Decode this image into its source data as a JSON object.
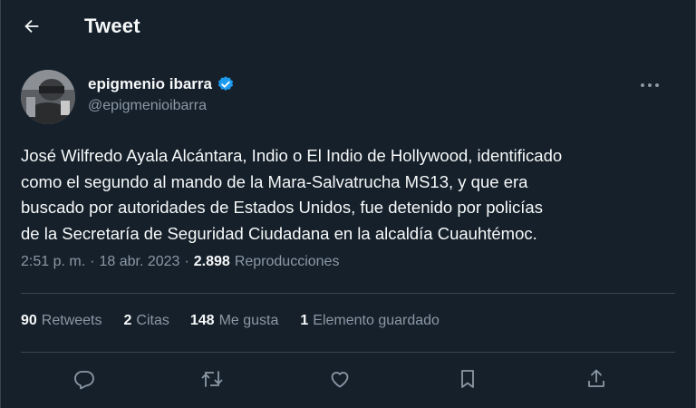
{
  "header": {
    "title": "Tweet",
    "back_icon": "arrow-left-icon"
  },
  "author": {
    "name": "epigmenio ibarra",
    "handle": "@epigmenioibarra",
    "verified": true,
    "verified_color": "#1d9bf0"
  },
  "tweet": {
    "text": "José Wilfredo Ayala Alcántara, Indio o El Indio de Hollywood, identificado\ncomo el segundo al mando de la Mara-Salvatrucha MS13, y que era\nbuscado por autoridades de Estados Unidos, fue detenido por policías\nde la Secretaría de Seguridad Ciudadana en la alcaldía Cuauhtémoc.",
    "time": "2:51 p. m.",
    "separator_1": "·",
    "date": "18 abr. 2023",
    "separator_2": "·",
    "views_count": "2.898",
    "views_label": "Reproducciones"
  },
  "stats": {
    "retweets_count": "90",
    "retweets_label": "Retweets",
    "quotes_count": "2",
    "quotes_label": "Citas",
    "likes_count": "148",
    "likes_label": "Me gusta",
    "bookmarks_count": "1",
    "bookmarks_label": "Elemento guardado"
  },
  "actions": [
    {
      "icon": "reply-icon"
    },
    {
      "icon": "retweet-icon"
    },
    {
      "icon": "like-icon"
    },
    {
      "icon": "bookmark-icon"
    },
    {
      "icon": "share-icon"
    }
  ],
  "colors": {
    "background": "#15202b",
    "primary_text": "#f7f9f9",
    "secondary_text": "#8b98a5",
    "border": "#38444d"
  }
}
